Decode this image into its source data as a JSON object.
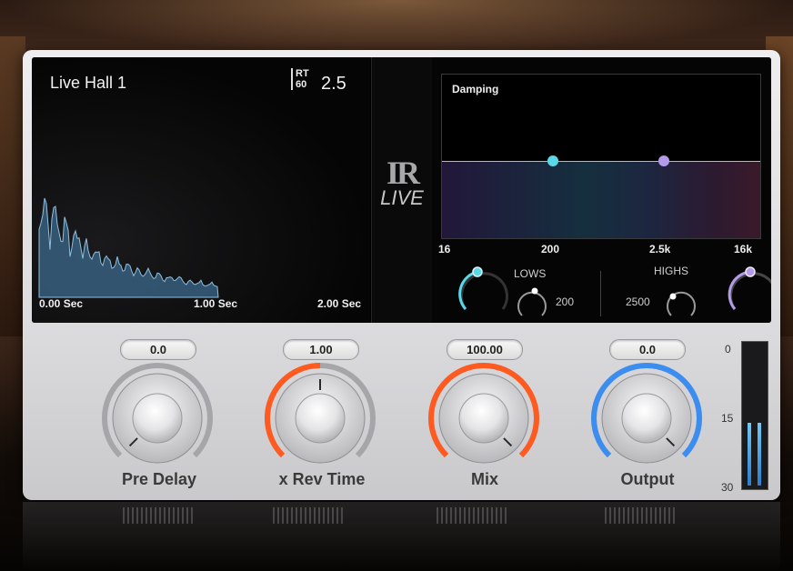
{
  "preset": {
    "name": "Live Hall 1",
    "rt_label_top": "RT",
    "rt_label_bottom": "60",
    "rt_value": "2.5"
  },
  "timeline": {
    "start": "0.00  Sec",
    "mid": "1.00  Sec",
    "end": "2.00  Sec"
  },
  "logo": {
    "top": "IR",
    "bottom": "LIVE"
  },
  "damping": {
    "title": "Damping",
    "freq_labels": [
      "16",
      "200",
      "2.5k",
      "16k"
    ],
    "lows_label": "LOWS",
    "lows_value": "200",
    "highs_label": "HIGHS",
    "highs_value": "2500",
    "low_dot_color": "#5ad8e8",
    "high_dot_color": "#b49ae8"
  },
  "knobs": [
    {
      "name": "Pre Delay",
      "value": "0.0",
      "arc_color": "#a0a0a4",
      "level": 0.0
    },
    {
      "name": "x Rev Time",
      "value": "1.00",
      "arc_color": "#ff5a1f",
      "level": 0.5
    },
    {
      "name": "Mix",
      "value": "100.00",
      "arc_color": "#ff5a1f",
      "level": 1.0
    },
    {
      "name": "Output",
      "value": "0.0",
      "arc_color": "#3b8ef0",
      "level": 1.0
    }
  ],
  "meter": {
    "scale": [
      "0",
      "15",
      "30"
    ],
    "left_level": 0.46,
    "right_level": 0.46
  },
  "colors": {
    "accent_orange": "#ff5a1f",
    "accent_blue": "#3b8ef0",
    "waveform": "#5a8fb8"
  }
}
